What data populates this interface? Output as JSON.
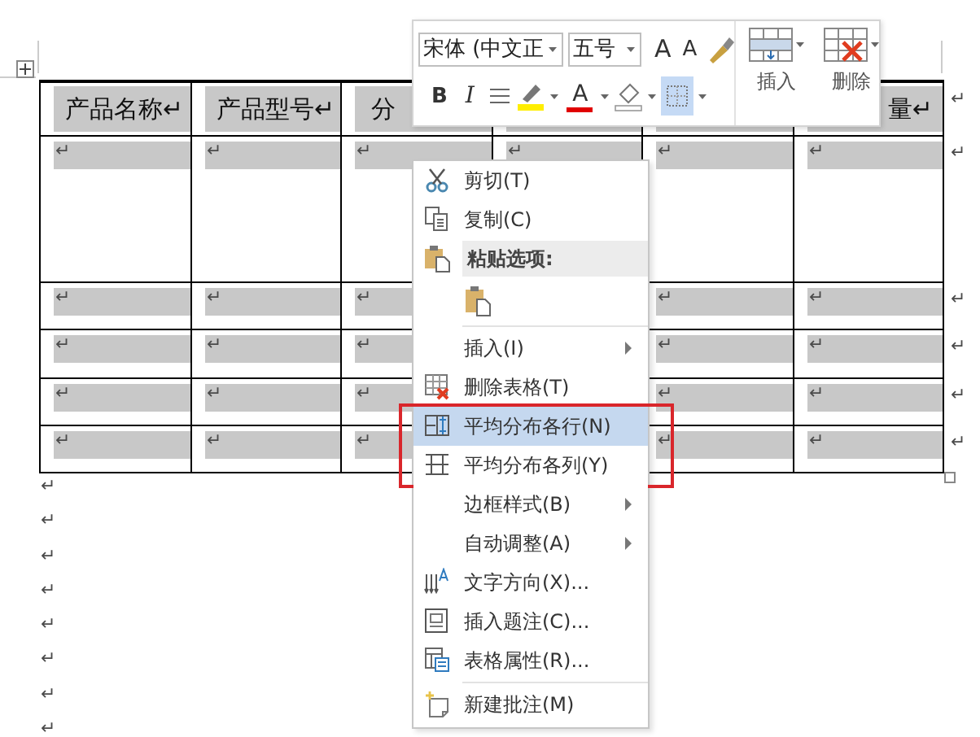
{
  "table": {
    "header": {
      "cells": [
        "产品名称↵",
        "产品型号↵",
        "分",
        null,
        null,
        "量↵"
      ],
      "end_mark": "↵"
    },
    "rows": [
      {
        "cells": [
          "↵",
          "↵",
          "↵",
          "↵",
          "↵",
          "↵"
        ],
        "end_mark": "↵"
      },
      {
        "cells": [
          "↵",
          "↵",
          "↵",
          null,
          "↵",
          "↵"
        ],
        "end_mark": "↵"
      },
      {
        "cells": [
          "↵",
          "↵",
          "↵",
          null,
          "↵",
          "↵"
        ],
        "end_mark": "↵"
      },
      {
        "cells": [
          "↵",
          "↵",
          "↵",
          null,
          "↵",
          "↵"
        ],
        "end_mark": "↵"
      },
      {
        "cells": [
          "↵",
          "↵",
          "↵",
          null,
          "↵",
          "↵"
        ],
        "end_mark": "↵"
      }
    ]
  },
  "paragraphs": [
    "↵",
    "↵",
    "↵",
    "↵",
    "↵",
    "↵",
    "↵",
    "↵"
  ],
  "toolbar": {
    "font": "宋体 (中文正",
    "size": "五号",
    "grow_font": "A",
    "shrink_font": "A",
    "bold": "B",
    "italic": "I",
    "font_color": "A",
    "borders_selected": true,
    "insert_label": "插入",
    "delete_label": "删除"
  },
  "menu": {
    "items": [
      {
        "kind": "item",
        "text": "剪切(T)",
        "submenu": false,
        "selected": false,
        "outlined": false
      },
      {
        "kind": "item",
        "text": "复制(C)",
        "submenu": false,
        "selected": false,
        "outlined": false
      },
      {
        "kind": "header",
        "text": "粘贴选项:"
      },
      {
        "kind": "paste"
      },
      {
        "kind": "separator"
      },
      {
        "kind": "item",
        "text": "插入(I)",
        "submenu": true,
        "selected": false,
        "outlined": false
      },
      {
        "kind": "item",
        "text": "删除表格(T)",
        "submenu": false,
        "selected": false,
        "outlined": false
      },
      {
        "kind": "item",
        "text": "平均分布各行(N)",
        "submenu": false,
        "selected": true,
        "outlined": true
      },
      {
        "kind": "item",
        "text": "平均分布各列(Y)",
        "submenu": false,
        "selected": false,
        "outlined": true
      },
      {
        "kind": "item",
        "text": "边框样式(B)",
        "submenu": true,
        "selected": false,
        "outlined": false
      },
      {
        "kind": "item",
        "text": "自动调整(A)",
        "submenu": true,
        "selected": false,
        "outlined": false
      },
      {
        "kind": "item",
        "text": "文字方向(X)...",
        "submenu": false,
        "selected": false,
        "outlined": false
      },
      {
        "kind": "item",
        "text": "插入题注(C)...",
        "submenu": false,
        "selected": false,
        "outlined": false
      },
      {
        "kind": "item",
        "text": "表格属性(R)...",
        "submenu": false,
        "selected": false,
        "outlined": false
      },
      {
        "kind": "separator"
      },
      {
        "kind": "item",
        "text": "新建批注(M)",
        "submenu": false,
        "selected": false,
        "outlined": false
      }
    ]
  }
}
